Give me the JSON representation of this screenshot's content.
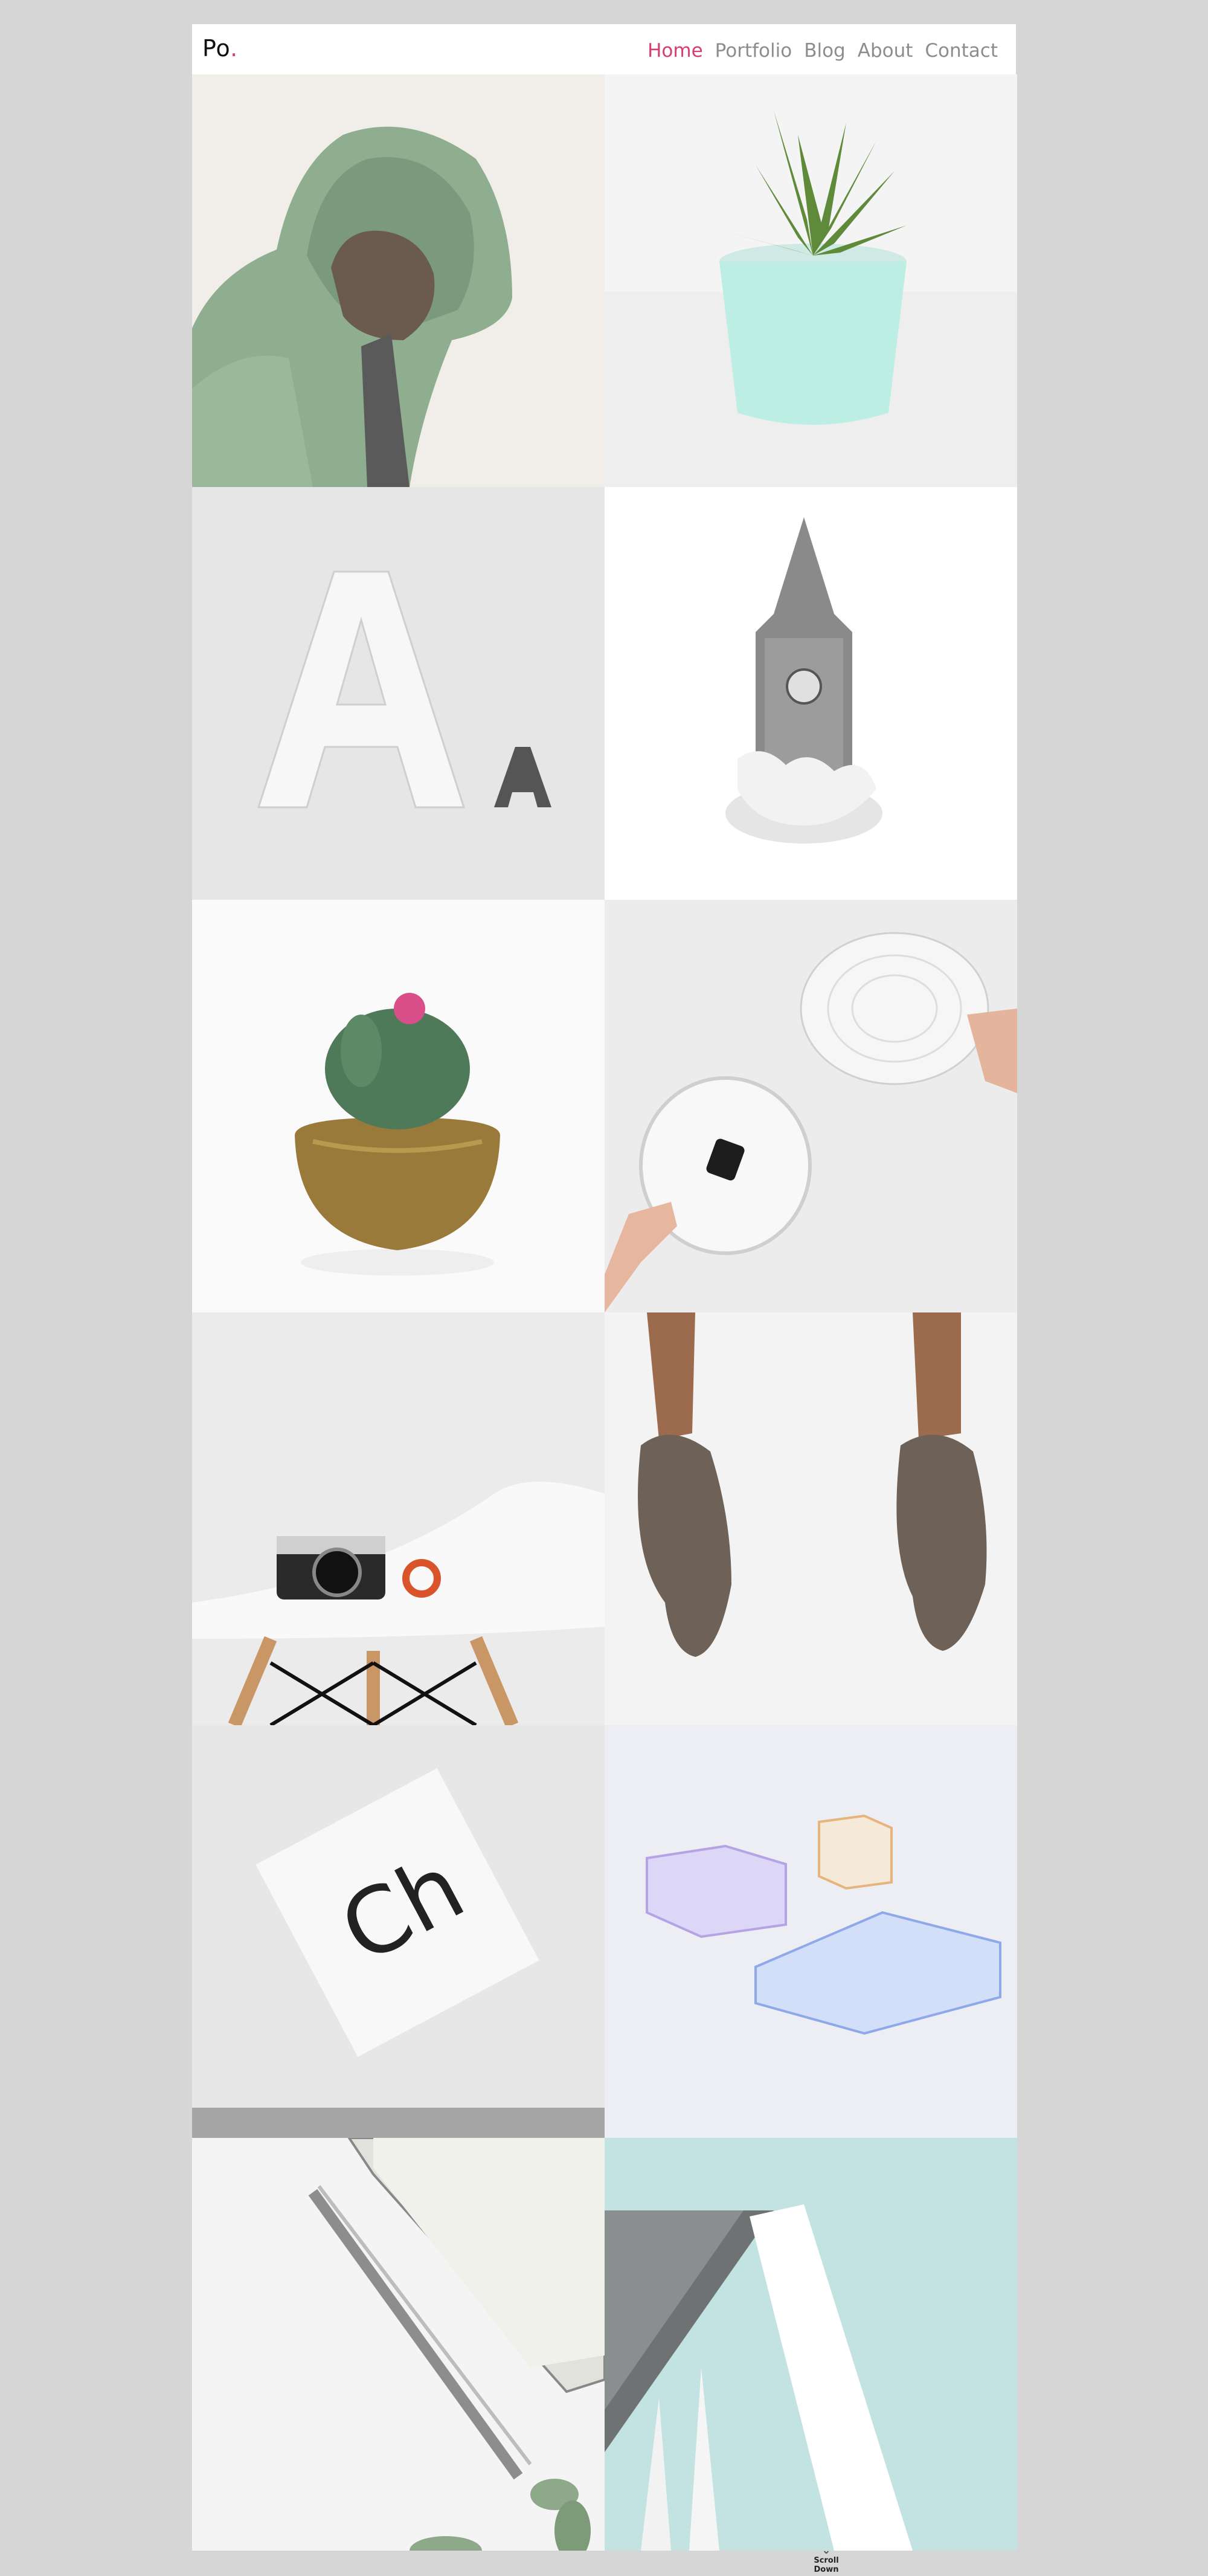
{
  "brand": {
    "logo_text": "Po",
    "logo_dot": "."
  },
  "nav": {
    "items": [
      {
        "label": "Home",
        "active": true
      },
      {
        "label": "Portfolio",
        "active": false
      },
      {
        "label": "Blog",
        "active": false
      },
      {
        "label": "About",
        "active": false
      },
      {
        "label": "Contact",
        "active": false
      }
    ]
  },
  "gallery": {
    "tiles": [
      {
        "name": "hooded-man"
      },
      {
        "name": "succulent-plant"
      },
      {
        "name": "letter-a"
      },
      {
        "name": "clock-tower"
      },
      {
        "name": "cactus-pot"
      },
      {
        "name": "wall-clock"
      },
      {
        "name": "camera-chair"
      },
      {
        "name": "metal-hands"
      },
      {
        "name": "typography-poster",
        "text": "Ch"
      },
      {
        "name": "glass-boxes"
      },
      {
        "name": "pencil-notebook"
      },
      {
        "name": "architecture"
      }
    ]
  },
  "scroll_down": {
    "label": "Scroll Down",
    "icon": "arrow-down-icon"
  },
  "colors": {
    "accent": "#d93c70",
    "background": "#d6d6d6"
  }
}
